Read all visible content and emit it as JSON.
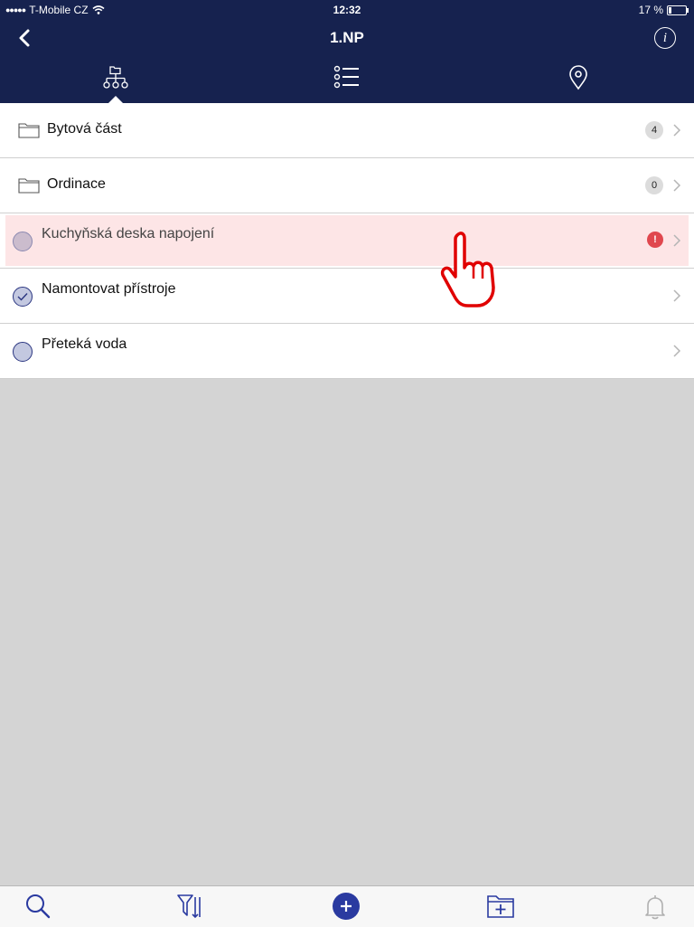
{
  "status_bar": {
    "carrier": "T-Mobile CZ",
    "time": "12:32",
    "battery": "17 %"
  },
  "nav": {
    "title": "1.NP",
    "info_symbol": "i",
    "tabs": [
      {
        "icon": "hierarchy-icon",
        "active": true
      },
      {
        "icon": "list-icon",
        "active": false
      },
      {
        "icon": "location-pin-icon",
        "active": false
      }
    ]
  },
  "list": {
    "items": [
      {
        "type": "folder",
        "label": "Bytová část",
        "count": "4"
      },
      {
        "type": "folder",
        "label": "Ordinace",
        "count": "0"
      },
      {
        "type": "task",
        "label": "Kuchyňská deska napojení",
        "alert": "!",
        "highlighted": true
      },
      {
        "type": "task",
        "label": "Namontovat přístroje",
        "checked": true
      },
      {
        "type": "task",
        "label": "Přeteká voda",
        "checked": false
      }
    ]
  },
  "toolbar": {
    "icons": [
      "search-icon",
      "filter-sort-icon",
      "add-icon",
      "add-folder-icon",
      "bell-icon"
    ]
  },
  "colors": {
    "nav_background": "#16224f",
    "accent": "#2a3aa0",
    "highlight_row": "#fde5e6",
    "alert": "#e0474e",
    "content_background": "#d4d4d4"
  }
}
